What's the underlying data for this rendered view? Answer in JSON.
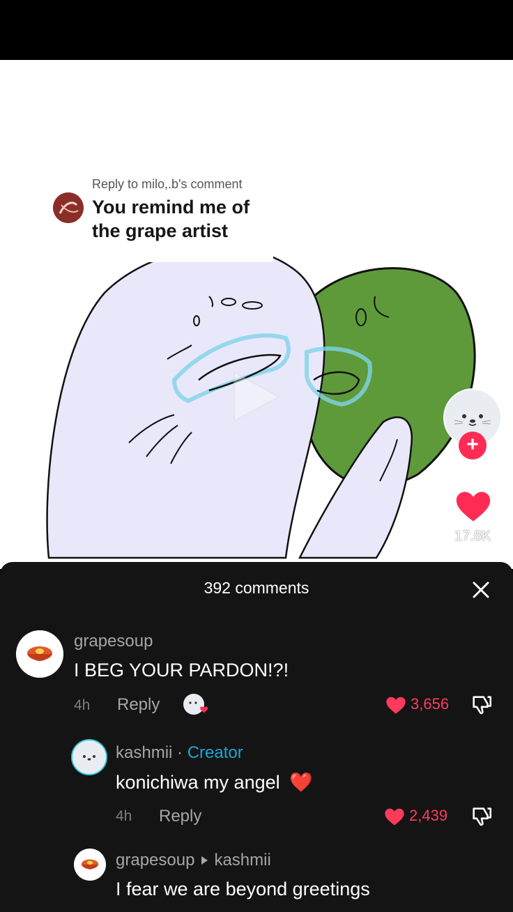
{
  "video": {
    "reply_to": "Reply to milo,.b's comment",
    "reply_text": "You remind me of the grape artist",
    "like_count": "17.8K",
    "follow_symbol": "+"
  },
  "comments_sheet": {
    "title": "392 comments",
    "comments": [
      {
        "username": "grapesoup",
        "text": "I BEG YOUR PARDON!?!",
        "time": "4h",
        "reply_label": "Reply",
        "likes": "3,656"
      },
      {
        "username": "kashmii",
        "separator": " · ",
        "badge": "Creator",
        "text": "konichiwa my angel",
        "emoji": "❤️",
        "time": "4h",
        "reply_label": "Reply",
        "likes": "2,439"
      },
      {
        "username": "grapesoup",
        "reply_to_user": "kashmii",
        "text": "I fear we are beyond greetings"
      }
    ]
  },
  "colors": {
    "accent_red": "#fe2c55",
    "creator_blue": "#1ea5d6",
    "seal_body": "#e9e8fa",
    "grape_green": "#5e9a3a"
  }
}
